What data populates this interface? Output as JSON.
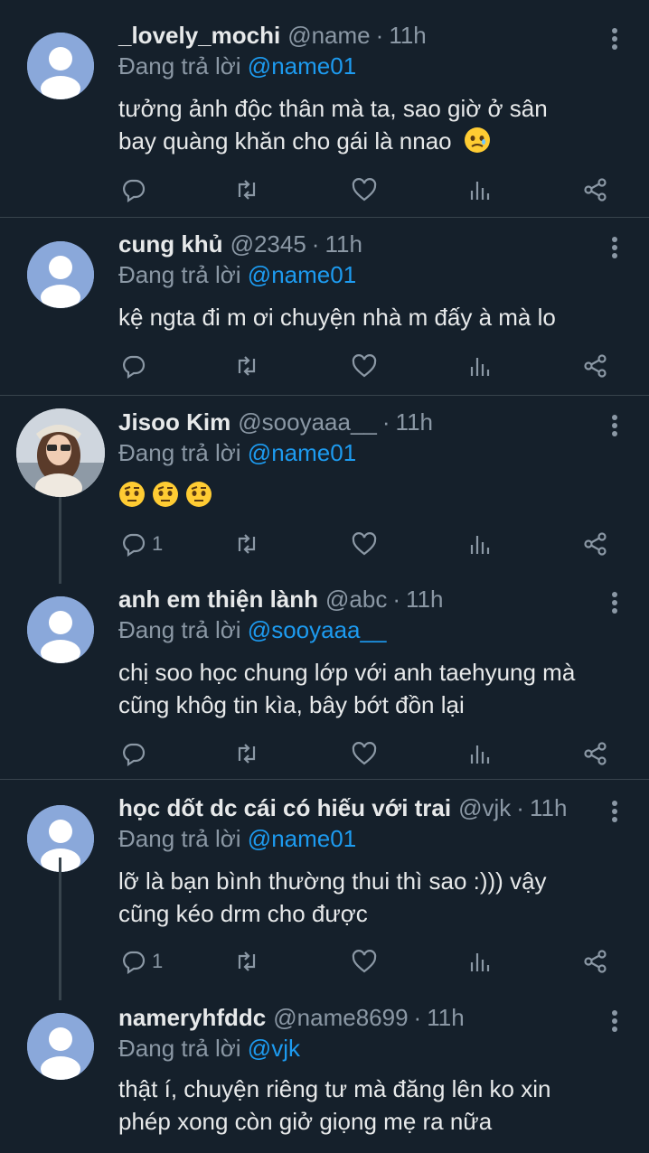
{
  "tweets": [
    {
      "name": "_lovely_mochi",
      "handle": "@name",
      "time": "11h",
      "reply_prefix": "Đang trả lời",
      "reply_to": "@name01",
      "text_lines": [
        "tưởng ảnh độc thân mà ta, sao giờ ở sân",
        "bay quàng khăn cho gái là nnao"
      ],
      "emoji": "face-holding-back-tears",
      "reply_count": ""
    },
    {
      "name": "cung khủ",
      "handle": "@2345",
      "time": "11h",
      "reply_prefix": "Đang trả lời",
      "reply_to": "@name01",
      "text_lines": [
        "kệ ngta đi m ơi chuyện nhà m đấy à mà lo"
      ],
      "reply_count": ""
    },
    {
      "name": "Jisoo Kim",
      "handle": "@sooyaaa__",
      "time": "11h",
      "reply_prefix": "Đang trả lời",
      "reply_to": "@name01",
      "text_lines": [],
      "emoji": "face-with-raised-eyebrow ×3",
      "reply_count": "1"
    },
    {
      "name": "anh em thiện lành",
      "handle": "@abc",
      "time": "11h",
      "reply_prefix": "Đang trả lời",
      "reply_to": "@sooyaaa__",
      "text_lines": [
        "chị soo học chung lớp với anh taehyung mà",
        "cũng khôg tin kìa, bây bớt đồn lại"
      ],
      "reply_count": ""
    },
    {
      "name": "học dốt dc cái có hiếu với trai",
      "handle": "@vjk",
      "time": "11h",
      "reply_prefix": "Đang trả lời",
      "reply_to": "@name01",
      "text_lines": [
        "lỡ là bạn bình thường thui thì sao :))) vậy",
        "cũng kéo drm cho được"
      ],
      "reply_count": "1"
    },
    {
      "name": "nameryhfddc",
      "handle": "@name8699",
      "time": "11h",
      "reply_prefix": "Đang trả lời",
      "reply_to": "@vjk",
      "text_lines": [
        "thật í, chuyện riêng tư mà đăng lên ko xin",
        "phép xong còn giở giọng mẹ ra nữa"
      ],
      "reply_count": ""
    }
  ],
  "icons": {
    "reply": "reply-icon",
    "retweet": "retweet-icon",
    "like": "like-icon",
    "views": "views-icon",
    "share": "share-icon",
    "more": "more-icon"
  },
  "colors": {
    "background": "#15202b",
    "mention": "#1d9bf0",
    "muted": "#8b98a5",
    "divider": "#38444d",
    "avatar": "#8aa8da"
  }
}
